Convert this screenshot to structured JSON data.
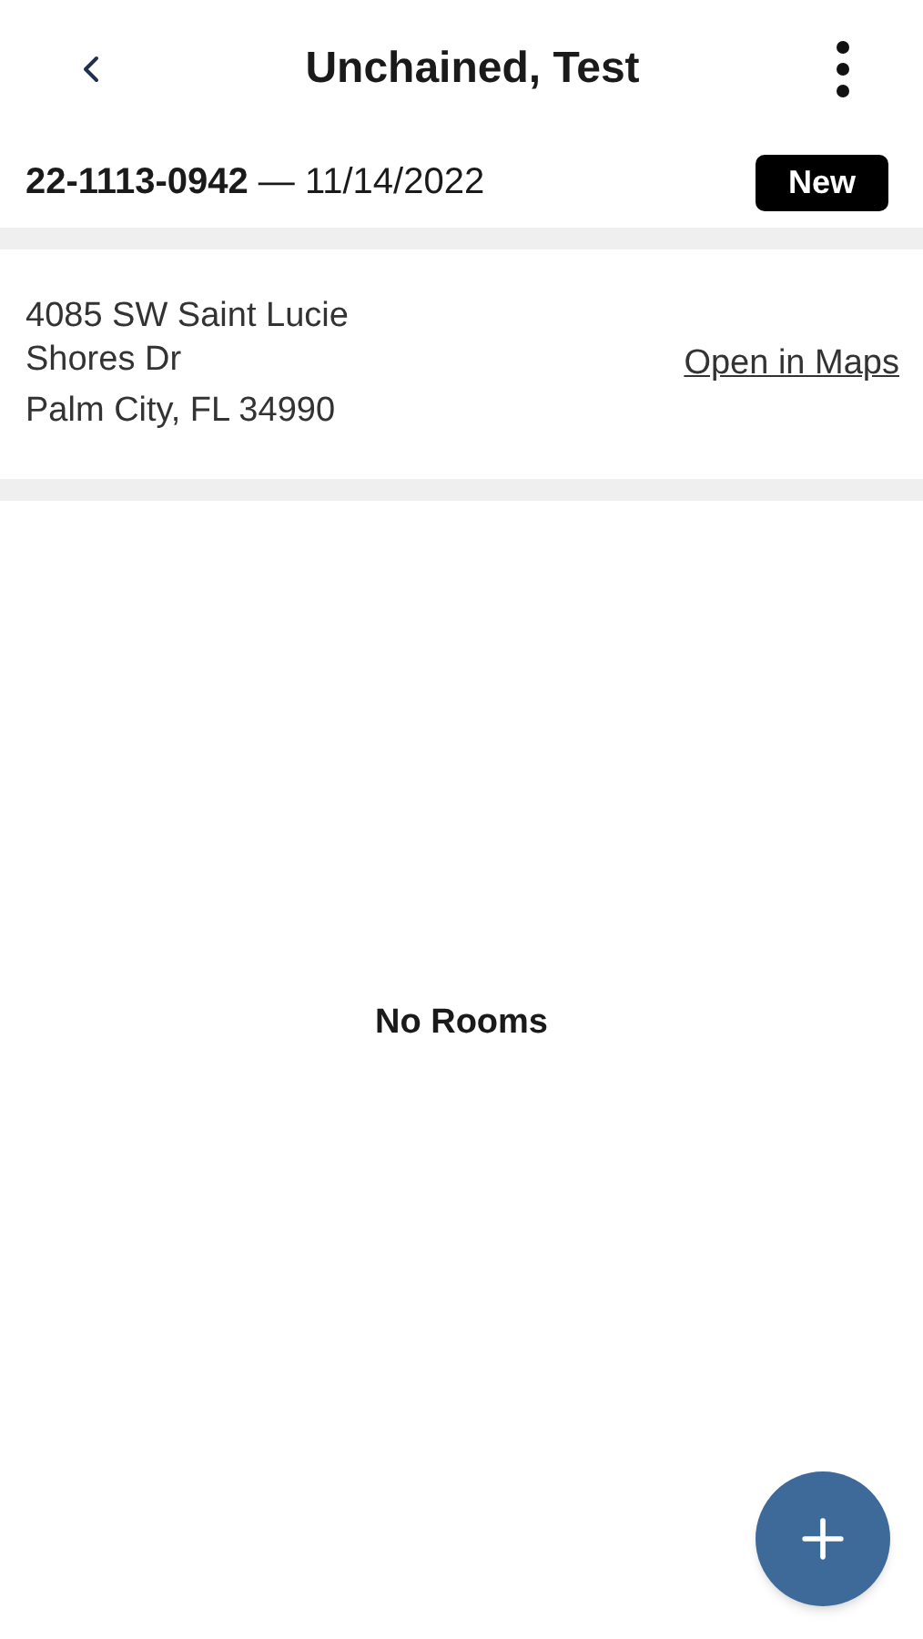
{
  "header": {
    "title": "Unchained, Test"
  },
  "job": {
    "line": "**22-1113-0942** — 11/14/2022",
    "status": "New"
  },
  "address": {
    "street": "4085 SW Saint Lucie Shores Dr",
    "city": "Palm City, FL 34990",
    "link": "Open in Maps"
  },
  "rooms": {
    "empty_text": "No Rooms"
  }
}
